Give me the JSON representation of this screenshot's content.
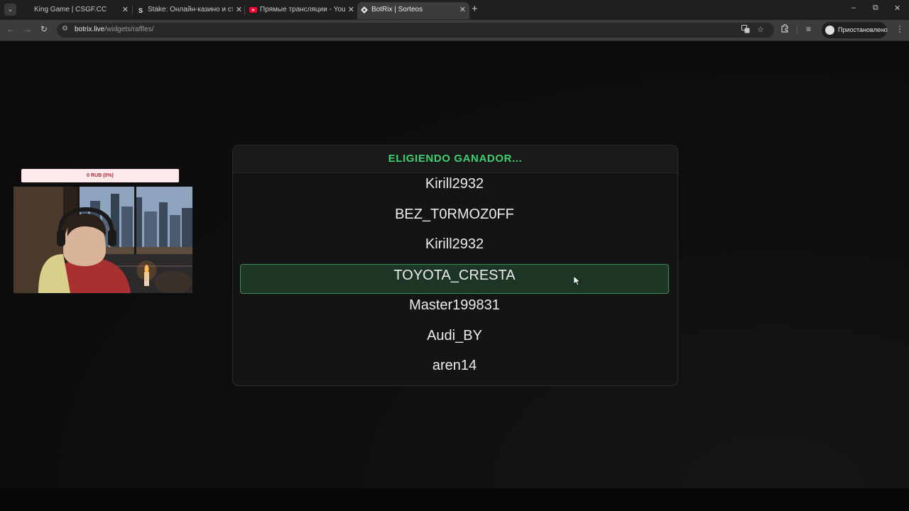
{
  "browser": {
    "tabs": [
      {
        "title": "King Game | CSGF.CC",
        "icon": "kinggame-favicon",
        "active": false
      },
      {
        "title": "Stake: Онлайн-казино и ставки",
        "icon": "stake-favicon",
        "active": false
      },
      {
        "title": "Прямые трансляции - YouTube",
        "icon": "youtube-favicon",
        "active": false
      },
      {
        "title": "BotRix | Sorteos",
        "icon": "botrix-favicon",
        "active": true
      }
    ],
    "address": {
      "host": "botrix.live",
      "path": "/widgets/raffles/"
    },
    "profile_label": "Приостановлено"
  },
  "overlay": {
    "progress_text": "0 RUB (0%)",
    "progress_fraction": 0.0
  },
  "raffle": {
    "header": "ELIGIENDO GANADOR...",
    "entries": [
      {
        "name": "Kirill2932",
        "highlighted": false
      },
      {
        "name": "BEZ_T0RMOZ0FF",
        "highlighted": false
      },
      {
        "name": "Kirill2932",
        "highlighted": false
      },
      {
        "name": "TOYOTA_CRESTA",
        "highlighted": true
      },
      {
        "name": "Master199831",
        "highlighted": false
      },
      {
        "name": "Audi_BY",
        "highlighted": false
      },
      {
        "name": "aren14",
        "highlighted": false
      }
    ]
  },
  "colors": {
    "header_green": "#3ecf6e",
    "winner_bg": "#1d3524",
    "winner_border": "#3b8f55",
    "progress_bg": "#fde8ea"
  }
}
